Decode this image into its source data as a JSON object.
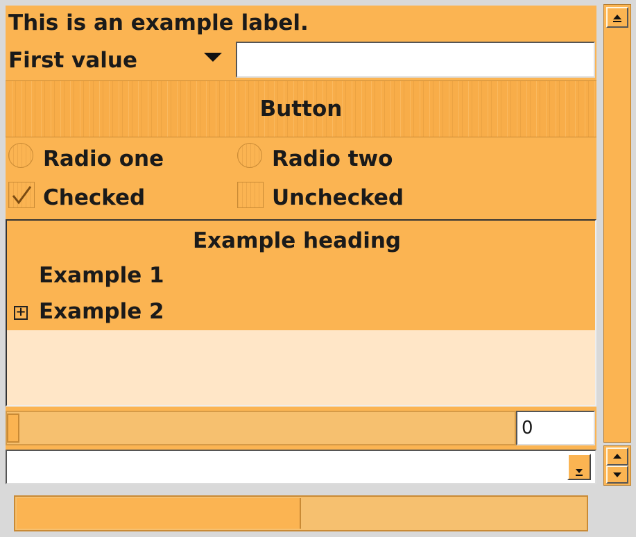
{
  "label": {
    "text": "This is an example label."
  },
  "combo": {
    "selected": "First value"
  },
  "entry": {
    "value": ""
  },
  "button": {
    "label": "Button"
  },
  "radios": [
    {
      "label": "Radio one",
      "checked": false
    },
    {
      "label": "Radio two",
      "checked": false
    }
  ],
  "checks": [
    {
      "label": "Checked",
      "checked": true
    },
    {
      "label": "Unchecked",
      "checked": false
    }
  ],
  "tree": {
    "heading": "Example heading",
    "rows": [
      "Example 1",
      "Example 2"
    ],
    "expander": "⊞"
  },
  "slider": {
    "value": "0",
    "level": 0
  },
  "combo_entry": {
    "value": ""
  },
  "progress": {
    "fraction": 0.5
  },
  "colors": {
    "accent": "#fbb452",
    "light": "#ffe6c7",
    "border": "#c98a35"
  },
  "icons": {
    "combo_arrow": "triangle-down-icon",
    "scroll_up": "arrow-up-icon",
    "spin_up": "arrow-up-icon",
    "spin_down": "arrow-down-icon",
    "dropdown": "arrow-down-icon",
    "check": "checkmark-icon",
    "expander": "plus-box-icon"
  }
}
